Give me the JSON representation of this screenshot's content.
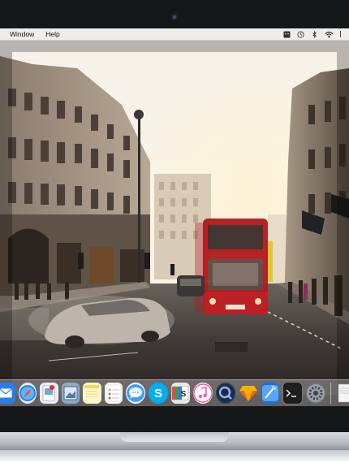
{
  "menubar": {
    "items": [
      "Window",
      "Help"
    ],
    "status_icons": [
      "finder-status-icon",
      "time-machine-icon",
      "bluetooth-icon",
      "wifi-icon"
    ]
  },
  "dock": {
    "apps": [
      {
        "name": "mail-icon",
        "color": "#2b7de9"
      },
      {
        "name": "safari-icon",
        "color": "#1e88e5"
      },
      {
        "name": "preview-icon",
        "color": "#e9eef5"
      },
      {
        "name": "image-capture-icon",
        "color": "#5c7fa8"
      },
      {
        "name": "notes-icon",
        "color": "#f6e27a"
      },
      {
        "name": "reminders-icon",
        "color": "#f2f2f2"
      },
      {
        "name": "messages-icon",
        "color": "#3aa1ff"
      },
      {
        "name": "skype-icon",
        "color": "#00aff0"
      },
      {
        "name": "slides-icon",
        "color": "#e8e8e8"
      },
      {
        "name": "itunes-icon",
        "color": "#f05fa0"
      },
      {
        "name": "quicktime-icon",
        "color": "#3a5f9e"
      },
      {
        "name": "sketch-icon",
        "color": "#f7b500"
      },
      {
        "name": "xcode-icon",
        "color": "#3f8fe3"
      },
      {
        "name": "terminal-icon",
        "color": "#1e1e1e"
      },
      {
        "name": "system-preferences-icon",
        "color": "#8a8f96"
      },
      {
        "name": "document-icon",
        "color": "#f4f4f4"
      }
    ]
  }
}
